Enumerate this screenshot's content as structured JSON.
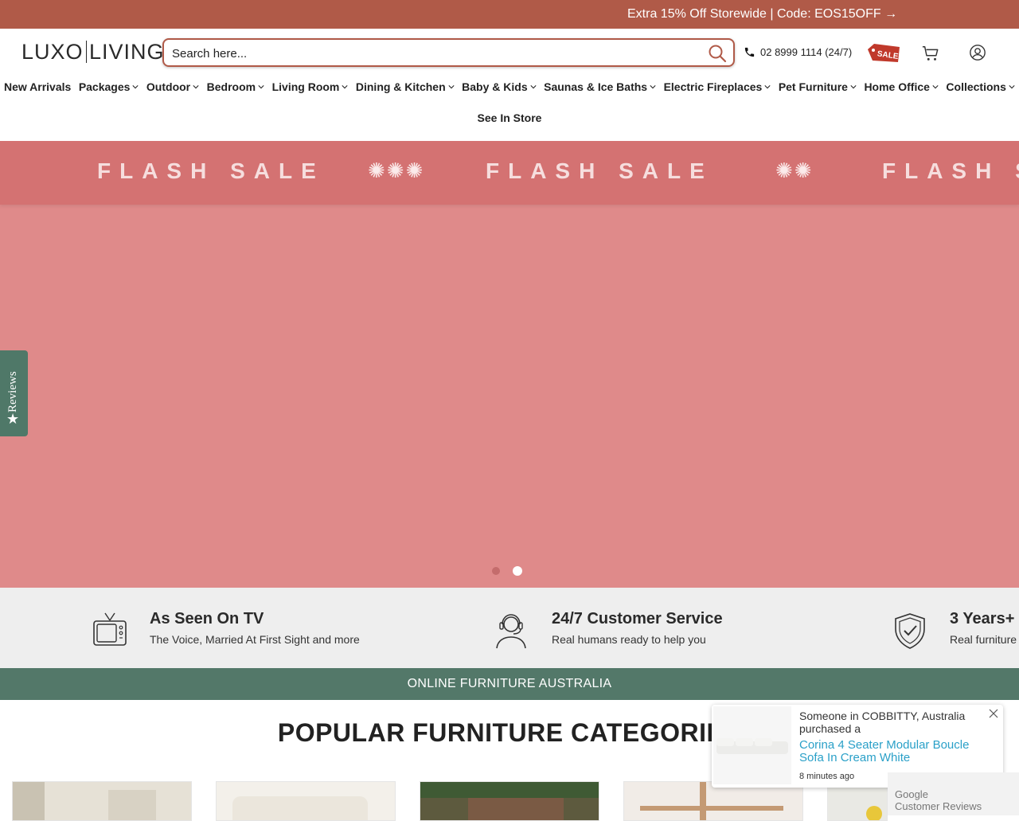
{
  "promo_bar": {
    "text": "Extra 15% Off Storewide | Code: EOS15OFF →"
  },
  "header": {
    "logo_left": "LUXO",
    "logo_right": "LIVING",
    "search_placeholder": "Search here...",
    "phone": "02 8999 1114  (24/7)",
    "sale_badge": "SALE"
  },
  "nav": {
    "items": [
      {
        "label": "New Arrivals",
        "has_dropdown": false
      },
      {
        "label": "Packages",
        "has_dropdown": true
      },
      {
        "label": "Outdoor",
        "has_dropdown": true
      },
      {
        "label": "Bedroom",
        "has_dropdown": true
      },
      {
        "label": "Living Room",
        "has_dropdown": true
      },
      {
        "label": "Dining & Kitchen",
        "has_dropdown": true
      },
      {
        "label": "Baby & Kids",
        "has_dropdown": true
      },
      {
        "label": "Saunas & Ice Baths",
        "has_dropdown": true
      },
      {
        "label": "Electric Fireplaces",
        "has_dropdown": true
      },
      {
        "label": "Pet Furniture",
        "has_dropdown": true
      },
      {
        "label": "Home Office",
        "has_dropdown": true
      },
      {
        "label": "Collections",
        "has_dropdown": true
      }
    ],
    "second_row": "See In Store"
  },
  "hero": {
    "banner_text": "FLASH SALE",
    "slide_count": 2,
    "active_slide": 2,
    "background_color": "#df8a8a"
  },
  "reviews_tab": {
    "label": "Reviews"
  },
  "features": [
    {
      "icon": "tv-icon",
      "title": "As Seen On TV",
      "subtitle": "The Voice, Married At First Sight and more"
    },
    {
      "icon": "headset-agent-icon",
      "title": "24/7 Customer Service",
      "subtitle": "Real humans ready to help you"
    },
    {
      "icon": "shield-check-icon",
      "title": "3 Years+",
      "subtitle": "Real furniture"
    }
  ],
  "green_band": {
    "text": "ONLINE FURNITURE AUSTRALIA"
  },
  "categories": {
    "title": "POPULAR FURNITURE CATEGORIES"
  },
  "purchase_popup": {
    "line1": "Someone in COBBITTY, Australia purchased a",
    "product": "Corina 4 Seater Modular Boucle Sofa In Cream White",
    "time": "8 minutes ago"
  },
  "google_badge": {
    "line1": "Google",
    "line2": "Customer Reviews"
  },
  "colors": {
    "brand": "#b05a48",
    "green": "#537869",
    "link": "#2aa0c8"
  }
}
